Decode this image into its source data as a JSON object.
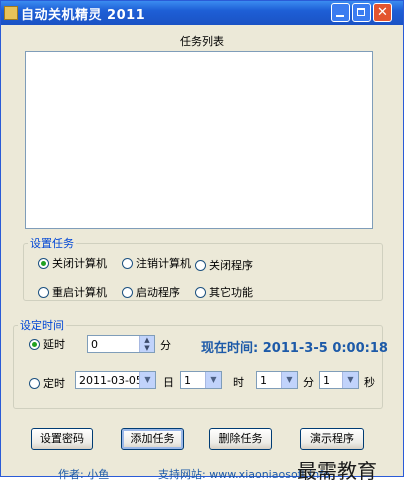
{
  "window": {
    "title": "自动关机精灵 2011"
  },
  "task_list": {
    "title": "任务列表"
  },
  "task_group": {
    "legend": "设置任务",
    "options": [
      "关闭计算机",
      "注销计算机",
      "关闭程序",
      "重启计算机",
      "启动程序",
      "其它功能"
    ],
    "selected": "关闭计算机"
  },
  "time_group": {
    "legend": "设定时间",
    "delay": {
      "label": "延时",
      "selected": true,
      "value": "0",
      "unit": "分"
    },
    "now_time": "现在时间: 2011-3-5 0:00:18",
    "schedule": {
      "label": "定时",
      "selected": false,
      "date": "2011-03-05",
      "day_unit": "日",
      "hour": "1",
      "hour_unit": "时",
      "minute": "1",
      "minute_unit": "分",
      "second": "1",
      "second_unit": "秒"
    }
  },
  "buttons": {
    "set_password": "设置密码",
    "add_task": "添加任务",
    "delete_task": "删除任务",
    "fourth": "演示程序"
  },
  "footer": {
    "author": "作者: 小鱼",
    "website": "支持网站: www.xiaoniaosoft.info"
  },
  "watermark": "最需教育"
}
